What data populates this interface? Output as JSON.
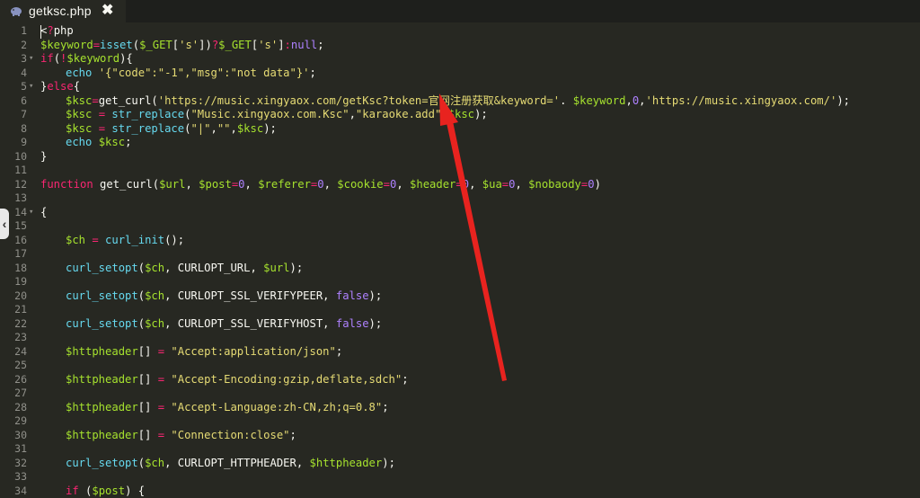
{
  "tab": {
    "title": "getksc.php",
    "close_glyph": "✖",
    "icon": "php-elephant-icon"
  },
  "side_collapse": {
    "glyph": "‹"
  },
  "colors": {
    "background": "#272822",
    "variable": "#a6e22e",
    "keyword": "#f92672",
    "function": "#66d9ef",
    "string": "#e6db74",
    "number": "#ae81ff",
    "annotation_arrow": "#e8231f"
  },
  "lines": [
    {
      "n": "1",
      "text": "<?php"
    },
    {
      "n": "2",
      "text": "$keyword=isset($_GET['s'])?$_GET['s']:null;"
    },
    {
      "n": "3",
      "text": "if(!$keyword){"
    },
    {
      "n": "4",
      "text": "echo '{\"code\":\"-1\",\"msg\":\"not data\"}';"
    },
    {
      "n": "5",
      "text": "}else{"
    },
    {
      "n": "6",
      "text": "$ksc=get_curl('https://music.xingyaox.com/getKsc?token=官网注册获取&keyword='. $keyword,0,'https://music.xingyaox.com/');"
    },
    {
      "n": "7",
      "text": "$ksc = str_replace(\"Music.xingyaox.com.Ksc\",\"karaoke.add\",$ksc);"
    },
    {
      "n": "8",
      "text": "$ksc = str_replace(\"|\",\"\",$ksc);"
    },
    {
      "n": "9",
      "text": "echo $ksc;"
    },
    {
      "n": "10",
      "text": "}"
    },
    {
      "n": "11",
      "text": ""
    },
    {
      "n": "12",
      "text": "function get_curl($url, $post=0, $referer=0, $cookie=0, $header=0, $ua=0, $nobaody=0)"
    },
    {
      "n": "13",
      "text": ""
    },
    {
      "n": "14",
      "text": "{"
    },
    {
      "n": "15",
      "text": ""
    },
    {
      "n": "16",
      "text": "$ch = curl_init();"
    },
    {
      "n": "17",
      "text": ""
    },
    {
      "n": "18",
      "text": "curl_setopt($ch, CURLOPT_URL, $url);"
    },
    {
      "n": "19",
      "text": ""
    },
    {
      "n": "20",
      "text": "curl_setopt($ch, CURLOPT_SSL_VERIFYPEER, false);"
    },
    {
      "n": "21",
      "text": ""
    },
    {
      "n": "22",
      "text": "curl_setopt($ch, CURLOPT_SSL_VERIFYHOST, false);"
    },
    {
      "n": "23",
      "text": ""
    },
    {
      "n": "24",
      "text": "$httpheader[] = \"Accept:application/json\";"
    },
    {
      "n": "25",
      "text": ""
    },
    {
      "n": "26",
      "text": "$httpheader[] = \"Accept-Encoding:gzip,deflate,sdch\";"
    },
    {
      "n": "27",
      "text": ""
    },
    {
      "n": "28",
      "text": "$httpheader[] = \"Accept-Language:zh-CN,zh;q=0.8\";"
    },
    {
      "n": "29",
      "text": ""
    },
    {
      "n": "30",
      "text": "$httpheader[] = \"Connection:close\";"
    },
    {
      "n": "31",
      "text": ""
    },
    {
      "n": "32",
      "text": "curl_setopt($ch, CURLOPT_HTTPHEADER, $httpheader);"
    },
    {
      "n": "33",
      "text": ""
    },
    {
      "n": "34",
      "text": "if ($post) {"
    }
  ]
}
